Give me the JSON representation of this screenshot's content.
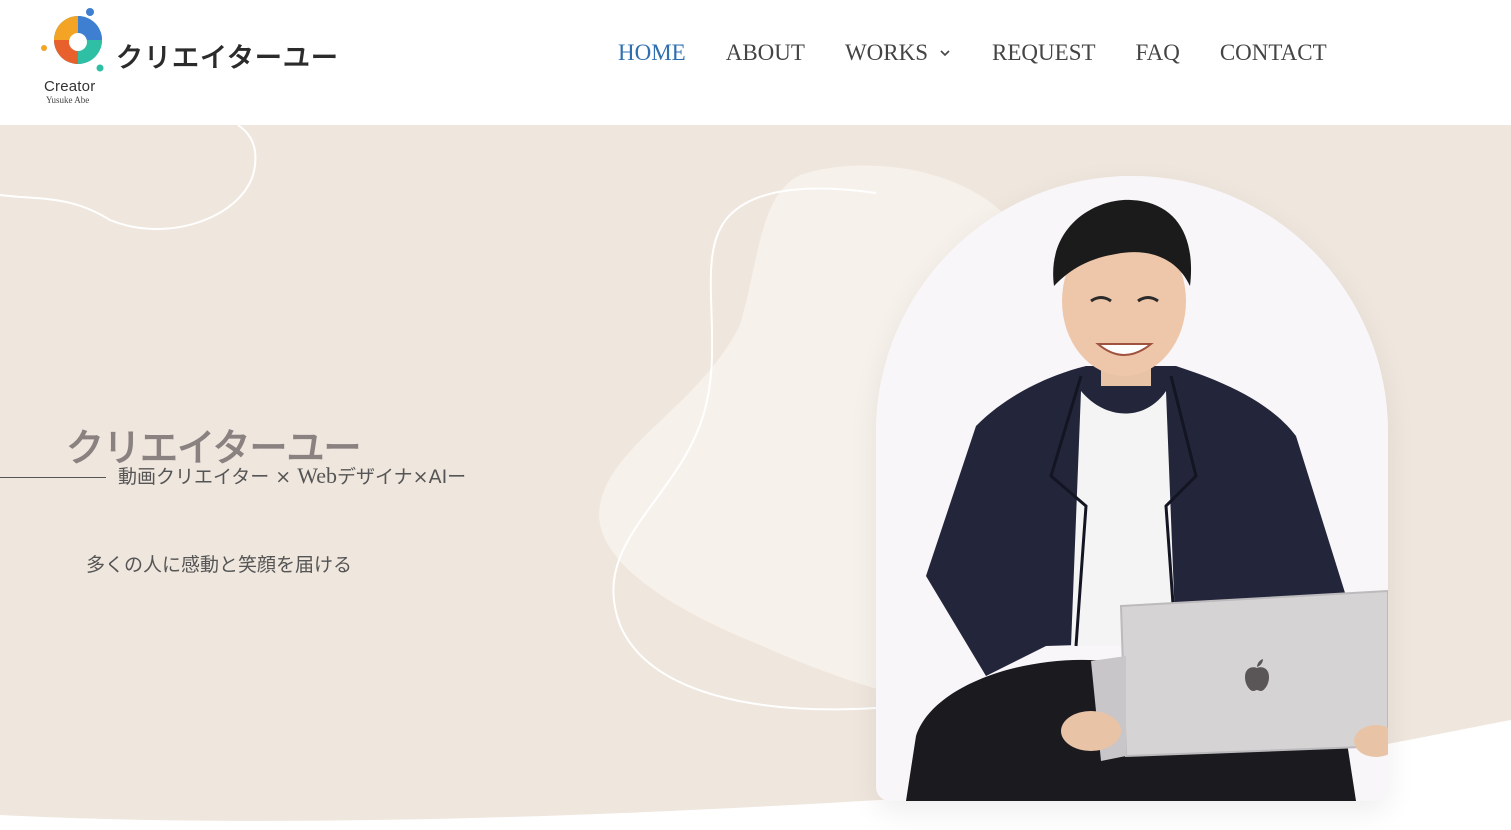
{
  "header": {
    "logo": {
      "name": "クリエイターユー",
      "word": "Creator",
      "subtitle": "Yusuke Abe"
    },
    "nav": [
      {
        "label": "HOME",
        "active": true
      },
      {
        "label": "ABOUT",
        "active": false
      },
      {
        "label": "WORKS",
        "active": false,
        "has_dropdown": true,
        "icon": "chevron-down-icon"
      },
      {
        "label": "REQUEST",
        "active": false
      },
      {
        "label": "FAQ",
        "active": false
      },
      {
        "label": "CONTACT",
        "active": false
      }
    ]
  },
  "hero": {
    "title": "クリエイターユー",
    "subtitle_prefix": "動画クリエイター × ",
    "subtitle_web": "Web",
    "subtitle_suffix": "デザイナ×AIー",
    "tagline": "多くの人に感動と笑顔を届ける",
    "photo": {
      "subject": "person-with-laptop",
      "icon": "apple-logo-icon"
    }
  },
  "colors": {
    "nav_active": "#2f6fb0",
    "nav_text": "#444444",
    "hero_bg": "#efe6dd",
    "blob": "#f6f1eb",
    "title": "#8a8280"
  }
}
